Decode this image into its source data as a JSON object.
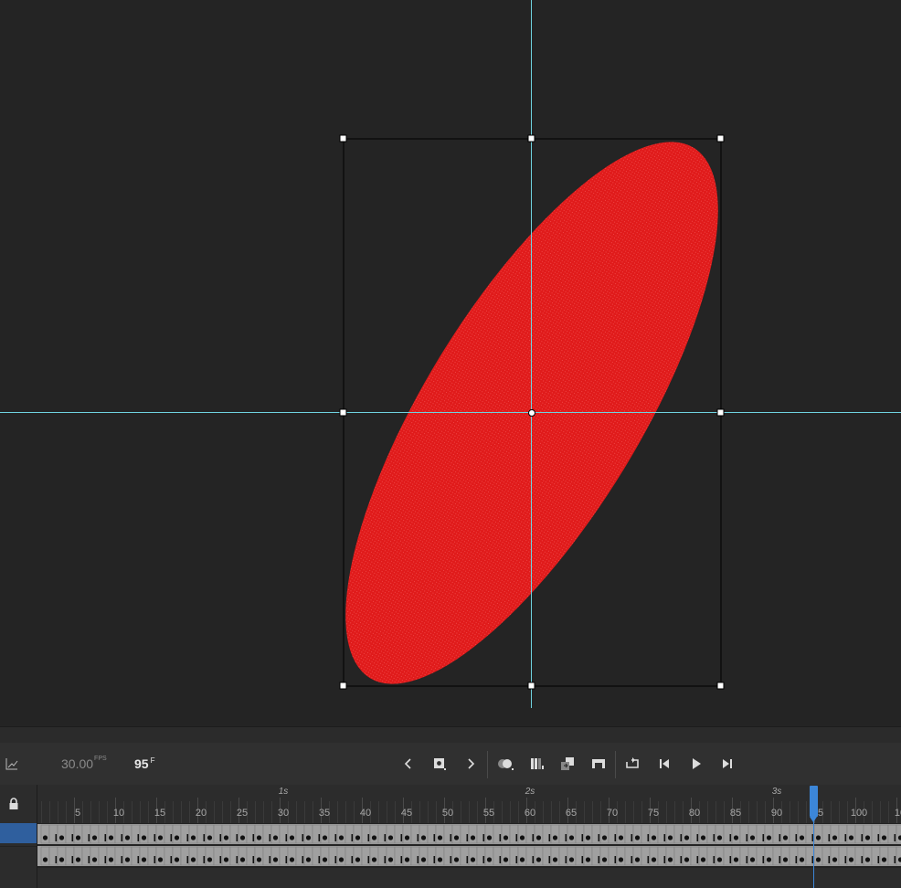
{
  "stage": {
    "background": "#242424",
    "shape": {
      "kind": "ellipse",
      "fill": "#e01b1b",
      "selected": true
    },
    "guide_color": "#6fd3e0"
  },
  "controls": {
    "fps_value": "30.00",
    "fps_unit": "FPS",
    "current_frame": "95",
    "frame_unit": "F",
    "buttons": [
      "previous-keyframe-icon",
      "insert-keyframe-icon",
      "next-keyframe-icon",
      "onion-skin-icon",
      "edit-multiple-frames-icon",
      "create-tween-icon",
      "insert-blank-keyframe-icon",
      "loop-icon",
      "step-back-icon",
      "play-icon",
      "step-forward-icon"
    ]
  },
  "timeline": {
    "frame_ticks": [
      "5",
      "10",
      "15",
      "20",
      "25",
      "30",
      "35",
      "40",
      "45",
      "50",
      "55",
      "60",
      "65",
      "70",
      "75",
      "80",
      "85",
      "90",
      "95",
      "100",
      "10"
    ],
    "second_marks": [
      "1s",
      "2s",
      "3s"
    ],
    "playhead_frame": 95,
    "selected_layer_color": "#2f5f9e",
    "playhead_color": "#3c86d8",
    "layers": [
      {
        "selected": true
      },
      {
        "selected": false
      }
    ]
  }
}
